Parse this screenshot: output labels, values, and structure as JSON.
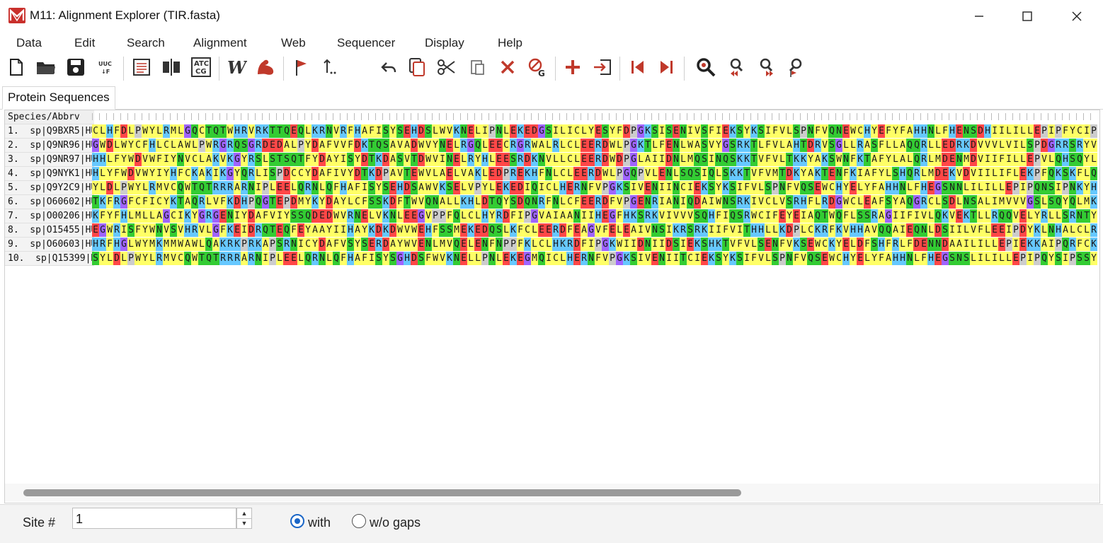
{
  "window": {
    "title": "M11: Alignment Explorer (TIR.fasta)",
    "app_icon": "mega-logo-icon",
    "controls": [
      "minimize-icon",
      "maximize-icon",
      "close-icon"
    ]
  },
  "menu": [
    "Data",
    "Edit",
    "Search",
    "Alignment",
    "Web",
    "Sequencer",
    "Display",
    "Help"
  ],
  "toolbar": {
    "icons": [
      "new-file-icon",
      "open-folder-icon",
      "save-disk-icon",
      "translate-uuc-icon",
      "view-text-icon",
      "align-columns-icon",
      "atcg-icon",
      "web-w-icon",
      "muscle-arm-icon",
      "flag-icon",
      "mark-site-icon",
      "undo-icon",
      "copy-icon",
      "cut-scissors-icon",
      "paste-icon",
      "delete-x-icon",
      "delete-gap-icon",
      "add-sequence-plus-icon",
      "import-icon",
      "move-left-icon",
      "move-right-icon",
      "search-icon",
      "find-previous-icon",
      "find-next-icon",
      "find-marked-icon"
    ]
  },
  "tab": {
    "label": "Protein Sequences"
  },
  "grid": {
    "header_label": "Species/Abbrv",
    "rows": [
      {
        "label": "1.  sp|Q9BXR5|HU",
        "seq": "CLHFDLPWYLRMLGQCTQTWHRVRKTTQEQLKRNVRFHAFISYSEHDSLWVKNELIPNLEKEDGSILICLYESYFDPGKSISENIVSFIEKSYKSIFVLSPNFVQNEWCHYEFYFAHHNLFHENSDHIILILLEPIPFYCIP"
      },
      {
        "label": "2.  sp|Q9NR96|HU",
        "seq": "GWDLWYCFHLCLAWLPWRGRQSGRDEDALPYDAFVVFDKTQSAVADWVYNELRGQLEECRGRWALRLCLEERDWLPGKTLFENLWASVYGSRKTLFVLAHTDRVSGLLRASFLLAQQRLLEDRKDVVVLVILSPDGRRSRYV"
      },
      {
        "label": "3.  sp|Q9NR97|HU",
        "seq": "HHLFYWDVWFIYNVCLAKVKGYRSLSTSQTFYDAYISYDTKDASVTDWVINELRYHLEESRDKNVLLCLEERDWDPGLAIIDNLMQSINQSKKTVFVLTKKYAKSWNFKTAFYLALQRLMDENMDVIIFILLEPVLQHSQYL"
      },
      {
        "label": "4.  sp|Q9NYK1|HU",
        "seq": "HLYFWDVWYIYHFCKAKIKGYQRLISPDCCYDAFIVYDTKDPAVTEWVLAELVAKLEDPREKHFNLCLEERDWLPGQPVLENLSQSIQLSKKTVFVMTDKYAKTENFKIAFYLSHQRLMDEKVDVIILIFLEKPFQKSKFLQ"
      },
      {
        "label": "5.  sp|Q9Y2C9|HU",
        "seq": "YLDLPWYLRMVCQWTQTRRRARNIPLEELQRNLQFHAFISYSEHDSAWVKSELVPYLEKEDIQICLHERNFVPGKSIVENIINCIEKSYKSIFVLSPNFVQSEWCHYELYFAHHNLFHEGSNNLILILLEPIPQNSIPNKYH"
      },
      {
        "label": "6.  sp|O60602|HU",
        "seq": "TKFRGFCFICYKTAQRLVFKDHPQGTEPDMYKYDAYLCFSSKDFTWVQNALLKHLDTQYSDQNRFNLCFEERDFVPGENRIANIQDAIWNSRKIVCLVSRHFLRDGWCLEAFSYAQGRCLSDLNSALIMVVVGSLSQYQLMK"
      },
      {
        "label": "7.  sp|O00206|HU",
        "seq": "KFYFHLMLLAGCIKYGRGENIYDAFVIYSSQDEDWVRNELVKNLEEGVPPFQLCLHYRDFIPGVAIAANIIHEGFHKSRKVIVVVSQHFIQSRWCIFEYEIAQTWQFLSSRAGIIFIVLQKVEKTLLRQQVELYRLLSRNTY"
      },
      {
        "label": "8.  sp|O15455|HU",
        "seq": "EGWRISFYWNVSVHRVLGFKEIDRQTEQFEYAAYIIHAYKDKDWVWEHFSSMEKEDQSLKFCLEERDFEAGVFELEAIVNSIKRSRKIIFVITHHLLKDPLCKRFKVHHAVQQAIEQNLDSIILVFLEEIPDYKLNHALCLR"
      },
      {
        "label": "9.  sp|O60603|HU",
        "seq": "HRFHGLWYMKMMWAWLQAKRKPRKAPSRNICYDAFVSYSERDAYWVENLMVQELENFNPPFKLCLHKRDFIPGKWIIDNIIDSIEKSHKTVFVLSENFVKSEWCKYELDFSHFRLFDENNDAAILILLEPIEKKAIPQRFCK"
      },
      {
        "label": "10.  sp|Q15399|H",
        "seq": "SYLDLPWYLRMVCQWTQTRRRARNIPLEELQRNLQFHAFISYSGHDSFWVKNELLPNLEKEGMQICLHERNFVPGKSIVENIITCIEKSYKSIFVLSPNFVQSEWCHYELYFAHHNLFHEGSNSLILILLEPIPQYSIPSSY"
      }
    ],
    "colors": {
      "A": "#ffff66",
      "V": "#ffff66",
      "L": "#ffff66",
      "I": "#ffff66",
      "M": "#ffff66",
      "F": "#ffff66",
      "W": "#ffff66",
      "C": "#ffff66",
      "Y": "#ffff66",
      "G": "#9f64ff",
      "P": "#cccccc",
      "S": "#33cc33",
      "T": "#33cc33",
      "N": "#33cc33",
      "Q": "#33cc33",
      "D": "#ff4747",
      "E": "#ff4747",
      "K": "#66c8ff",
      "R": "#66c8ff",
      "H": "#66c8ff"
    }
  },
  "status": {
    "site_label": "Site #",
    "site_value": "1",
    "radio_with": "with",
    "radio_without": "w/o gaps",
    "selected": "with"
  }
}
